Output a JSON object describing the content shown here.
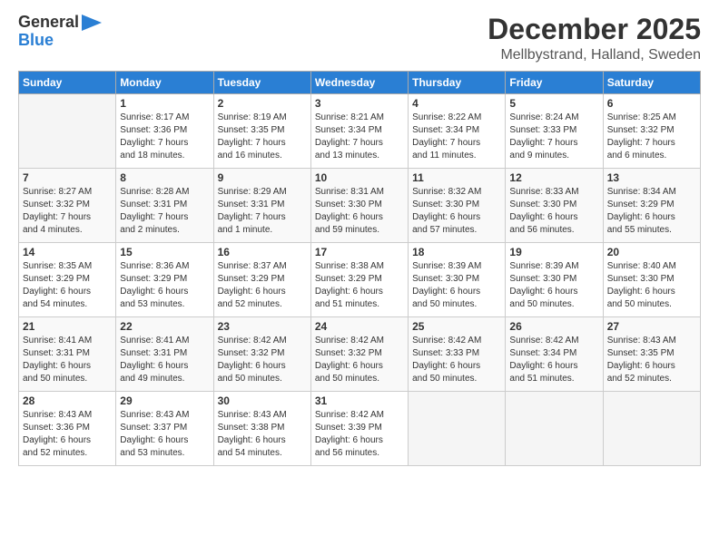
{
  "header": {
    "logo_line1": "General",
    "logo_line2": "Blue",
    "month": "December 2025",
    "location": "Mellbystrand, Halland, Sweden"
  },
  "weekdays": [
    "Sunday",
    "Monday",
    "Tuesday",
    "Wednesday",
    "Thursday",
    "Friday",
    "Saturday"
  ],
  "weeks": [
    [
      {
        "day": "",
        "content": ""
      },
      {
        "day": "1",
        "content": "Sunrise: 8:17 AM\nSunset: 3:36 PM\nDaylight: 7 hours\nand 18 minutes."
      },
      {
        "day": "2",
        "content": "Sunrise: 8:19 AM\nSunset: 3:35 PM\nDaylight: 7 hours\nand 16 minutes."
      },
      {
        "day": "3",
        "content": "Sunrise: 8:21 AM\nSunset: 3:34 PM\nDaylight: 7 hours\nand 13 minutes."
      },
      {
        "day": "4",
        "content": "Sunrise: 8:22 AM\nSunset: 3:34 PM\nDaylight: 7 hours\nand 11 minutes."
      },
      {
        "day": "5",
        "content": "Sunrise: 8:24 AM\nSunset: 3:33 PM\nDaylight: 7 hours\nand 9 minutes."
      },
      {
        "day": "6",
        "content": "Sunrise: 8:25 AM\nSunset: 3:32 PM\nDaylight: 7 hours\nand 6 minutes."
      }
    ],
    [
      {
        "day": "7",
        "content": "Sunrise: 8:27 AM\nSunset: 3:32 PM\nDaylight: 7 hours\nand 4 minutes."
      },
      {
        "day": "8",
        "content": "Sunrise: 8:28 AM\nSunset: 3:31 PM\nDaylight: 7 hours\nand 2 minutes."
      },
      {
        "day": "9",
        "content": "Sunrise: 8:29 AM\nSunset: 3:31 PM\nDaylight: 7 hours\nand 1 minute."
      },
      {
        "day": "10",
        "content": "Sunrise: 8:31 AM\nSunset: 3:30 PM\nDaylight: 6 hours\nand 59 minutes."
      },
      {
        "day": "11",
        "content": "Sunrise: 8:32 AM\nSunset: 3:30 PM\nDaylight: 6 hours\nand 57 minutes."
      },
      {
        "day": "12",
        "content": "Sunrise: 8:33 AM\nSunset: 3:30 PM\nDaylight: 6 hours\nand 56 minutes."
      },
      {
        "day": "13",
        "content": "Sunrise: 8:34 AM\nSunset: 3:29 PM\nDaylight: 6 hours\nand 55 minutes."
      }
    ],
    [
      {
        "day": "14",
        "content": "Sunrise: 8:35 AM\nSunset: 3:29 PM\nDaylight: 6 hours\nand 54 minutes."
      },
      {
        "day": "15",
        "content": "Sunrise: 8:36 AM\nSunset: 3:29 PM\nDaylight: 6 hours\nand 53 minutes."
      },
      {
        "day": "16",
        "content": "Sunrise: 8:37 AM\nSunset: 3:29 PM\nDaylight: 6 hours\nand 52 minutes."
      },
      {
        "day": "17",
        "content": "Sunrise: 8:38 AM\nSunset: 3:29 PM\nDaylight: 6 hours\nand 51 minutes."
      },
      {
        "day": "18",
        "content": "Sunrise: 8:39 AM\nSunset: 3:30 PM\nDaylight: 6 hours\nand 50 minutes."
      },
      {
        "day": "19",
        "content": "Sunrise: 8:39 AM\nSunset: 3:30 PM\nDaylight: 6 hours\nand 50 minutes."
      },
      {
        "day": "20",
        "content": "Sunrise: 8:40 AM\nSunset: 3:30 PM\nDaylight: 6 hours\nand 50 minutes."
      }
    ],
    [
      {
        "day": "21",
        "content": "Sunrise: 8:41 AM\nSunset: 3:31 PM\nDaylight: 6 hours\nand 50 minutes."
      },
      {
        "day": "22",
        "content": "Sunrise: 8:41 AM\nSunset: 3:31 PM\nDaylight: 6 hours\nand 49 minutes."
      },
      {
        "day": "23",
        "content": "Sunrise: 8:42 AM\nSunset: 3:32 PM\nDaylight: 6 hours\nand 50 minutes."
      },
      {
        "day": "24",
        "content": "Sunrise: 8:42 AM\nSunset: 3:32 PM\nDaylight: 6 hours\nand 50 minutes."
      },
      {
        "day": "25",
        "content": "Sunrise: 8:42 AM\nSunset: 3:33 PM\nDaylight: 6 hours\nand 50 minutes."
      },
      {
        "day": "26",
        "content": "Sunrise: 8:42 AM\nSunset: 3:34 PM\nDaylight: 6 hours\nand 51 minutes."
      },
      {
        "day": "27",
        "content": "Sunrise: 8:43 AM\nSunset: 3:35 PM\nDaylight: 6 hours\nand 52 minutes."
      }
    ],
    [
      {
        "day": "28",
        "content": "Sunrise: 8:43 AM\nSunset: 3:36 PM\nDaylight: 6 hours\nand 52 minutes."
      },
      {
        "day": "29",
        "content": "Sunrise: 8:43 AM\nSunset: 3:37 PM\nDaylight: 6 hours\nand 53 minutes."
      },
      {
        "day": "30",
        "content": "Sunrise: 8:43 AM\nSunset: 3:38 PM\nDaylight: 6 hours\nand 54 minutes."
      },
      {
        "day": "31",
        "content": "Sunrise: 8:42 AM\nSunset: 3:39 PM\nDaylight: 6 hours\nand 56 minutes."
      },
      {
        "day": "",
        "content": ""
      },
      {
        "day": "",
        "content": ""
      },
      {
        "day": "",
        "content": ""
      }
    ]
  ]
}
